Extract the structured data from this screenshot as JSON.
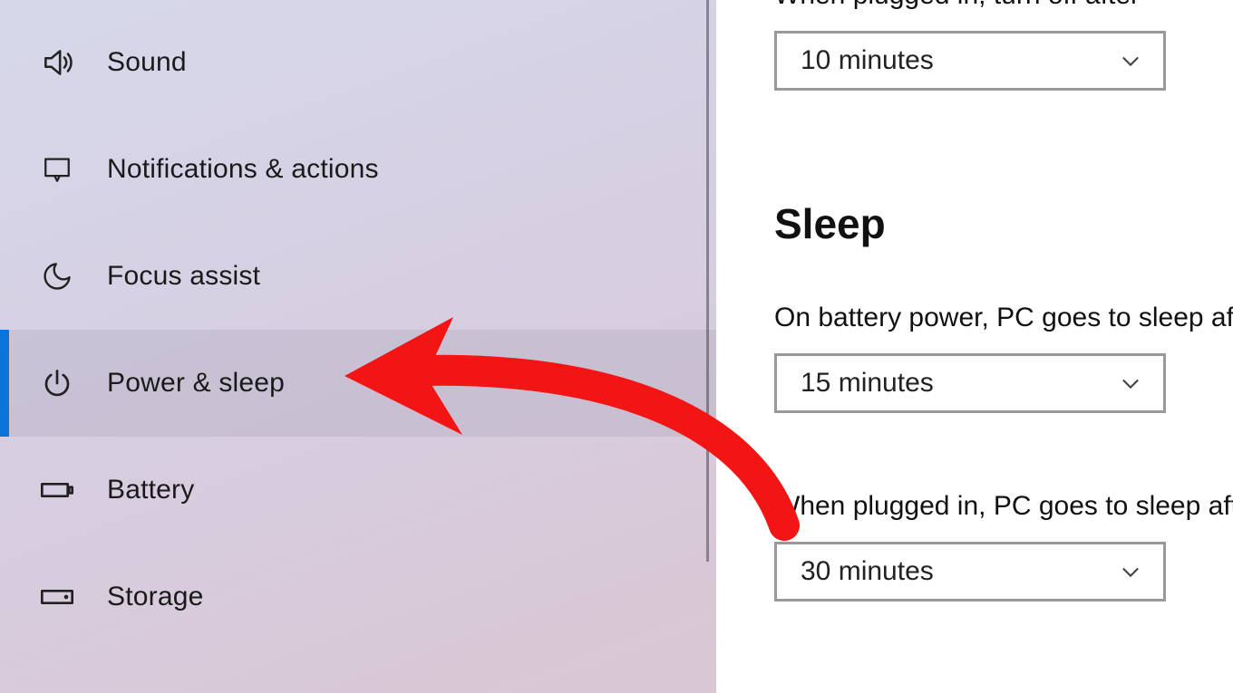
{
  "sidebar": {
    "items": [
      {
        "icon": "sound-icon",
        "label": "Sound"
      },
      {
        "icon": "notifications-icon",
        "label": "Notifications & actions"
      },
      {
        "icon": "focus-assist-icon",
        "label": "Focus assist"
      },
      {
        "icon": "power-icon",
        "label": "Power & sleep"
      },
      {
        "icon": "battery-icon",
        "label": "Battery"
      },
      {
        "icon": "storage-icon",
        "label": "Storage"
      }
    ],
    "selected_index": 3
  },
  "main": {
    "screen_off": {
      "plugged_label": "When plugged in, turn off after",
      "plugged_value": "10 minutes"
    },
    "sleep_heading": "Sleep",
    "sleep": {
      "battery_label": "On battery power, PC goes to sleep after",
      "battery_value": "15 minutes",
      "plugged_label": "When plugged in, PC goes to sleep after",
      "plugged_value": "30 minutes"
    }
  },
  "annotation": {
    "arrow_color": "#f31414"
  }
}
